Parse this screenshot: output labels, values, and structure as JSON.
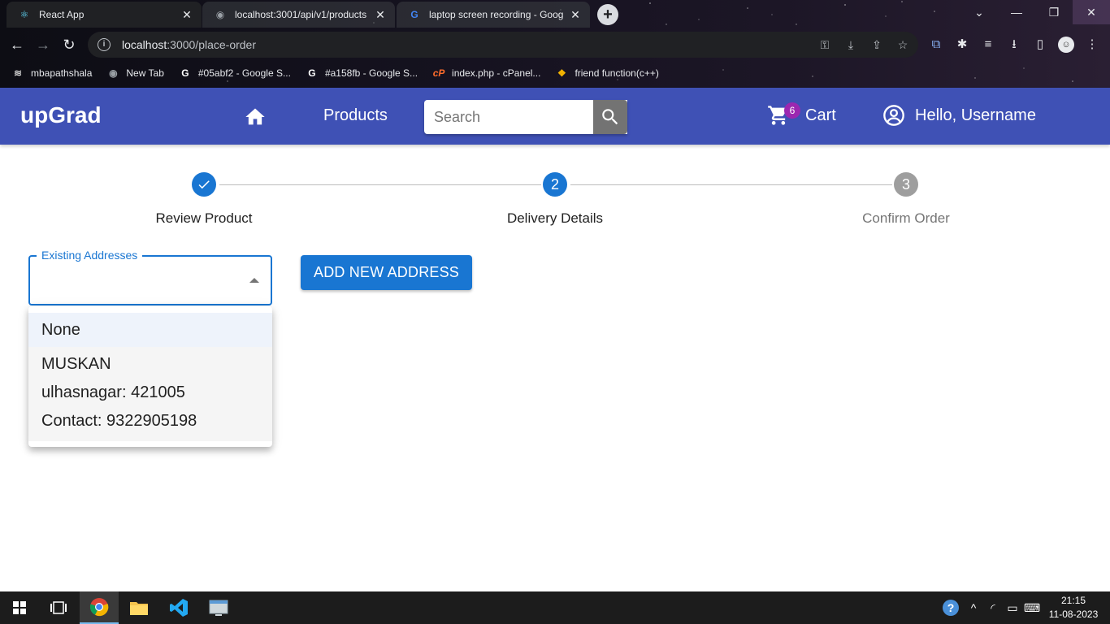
{
  "browser": {
    "tabs": [
      {
        "title": "React App",
        "favicon": "react-icon",
        "active": true
      },
      {
        "title": "localhost:3001/api/v1/products",
        "favicon": "globe-icon",
        "active": false
      },
      {
        "title": "laptop screen recording - Google",
        "favicon": "google-icon",
        "active": false
      }
    ],
    "address": {
      "host": "localhost",
      "rest": ":3000/place-order"
    },
    "bookmarks": [
      {
        "label": "mbapathshala",
        "icon": "mba-icon"
      },
      {
        "label": "New Tab",
        "icon": "globe-icon"
      },
      {
        "label": "#05abf2 - Google S...",
        "icon": "google-icon"
      },
      {
        "label": "#a158fb - Google S...",
        "icon": "google-icon"
      },
      {
        "label": "index.php - cPanel...",
        "icon": "cpanel-icon"
      },
      {
        "label": "friend function(c++)",
        "icon": "bookmark-icon"
      }
    ]
  },
  "app": {
    "brand": "upGrad",
    "nav": {
      "products": "Products"
    },
    "search": {
      "placeholder": "Search",
      "value": ""
    },
    "cart": {
      "label": "Cart",
      "count": "6"
    },
    "user": {
      "greeting": "Hello, Username"
    },
    "colors": {
      "appbar": "#3f51b5",
      "primary": "#1976d2",
      "badge": "#9c27b0",
      "pending": "#9e9e9e"
    }
  },
  "stepper": {
    "steps": [
      {
        "label": "Review Product",
        "number": "1",
        "state": "completed"
      },
      {
        "label": "Delivery Details",
        "number": "2",
        "state": "active"
      },
      {
        "label": "Confirm Order",
        "number": "3",
        "state": "pending"
      }
    ]
  },
  "address_form": {
    "select_label": "Existing Addresses",
    "selected_value": "",
    "add_button": "ADD NEW ADDRESS",
    "options": [
      {
        "label": "None"
      },
      {
        "name": "MUSKAN",
        "location": "ulhasnagar: 421005",
        "contact": "Contact: 9322905198"
      }
    ]
  },
  "taskbar": {
    "time": "21:15",
    "date": "11-08-2023"
  }
}
